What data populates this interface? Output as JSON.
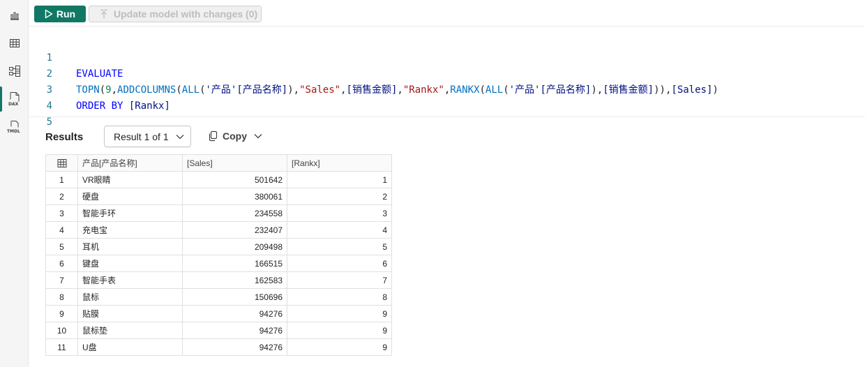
{
  "toolbar": {
    "run_label": "Run",
    "update_label": "Update model with changes (0)"
  },
  "rail": {
    "dax_label": "DAX",
    "tmdl_label": "TMDL"
  },
  "editor": {
    "line_numbers": [
      "1",
      "2",
      "3",
      "4",
      "5"
    ],
    "lines": [
      "EVALUATE",
      "TOPN(9,ADDCOLUMNS(ALL('产品'[产品名称]),\"Sales\",[销售金额],\"Rankx\",RANKX(ALL('产品'[产品名称]),[销售金额])),[Sales])",
      "ORDER BY [Rankx]",
      "",
      ""
    ]
  },
  "results": {
    "title": "Results",
    "selector_value": "Result 1 of 1",
    "copy_label": "Copy"
  },
  "table": {
    "columns": [
      "产品[产品名称]",
      "[Sales]",
      "[Rankx]"
    ],
    "rows": [
      {
        "idx": "1",
        "name": "VR眼睛",
        "sales": "501642",
        "rank": "1"
      },
      {
        "idx": "2",
        "name": "硬盘",
        "sales": "380061",
        "rank": "2"
      },
      {
        "idx": "3",
        "name": "智能手环",
        "sales": "234558",
        "rank": "3"
      },
      {
        "idx": "4",
        "name": "充电宝",
        "sales": "232407",
        "rank": "4"
      },
      {
        "idx": "5",
        "name": "耳机",
        "sales": "209498",
        "rank": "5"
      },
      {
        "idx": "6",
        "name": "键盘",
        "sales": "166515",
        "rank": "6"
      },
      {
        "idx": "7",
        "name": "智能手表",
        "sales": "162583",
        "rank": "7"
      },
      {
        "idx": "8",
        "name": "鼠标",
        "sales": "150696",
        "rank": "8"
      },
      {
        "idx": "9",
        "name": "贴膜",
        "sales": "94276",
        "rank": "9"
      },
      {
        "idx": "10",
        "name": "鼠标垫",
        "sales": "94276",
        "rank": "9"
      },
      {
        "idx": "11",
        "name": "U盘",
        "sales": "94276",
        "rank": "9"
      }
    ]
  },
  "colors": {
    "accent": "#117865",
    "keyword": "#0000ff",
    "function": "#0070c1",
    "string": "#a31515",
    "line_number": "#237893"
  }
}
